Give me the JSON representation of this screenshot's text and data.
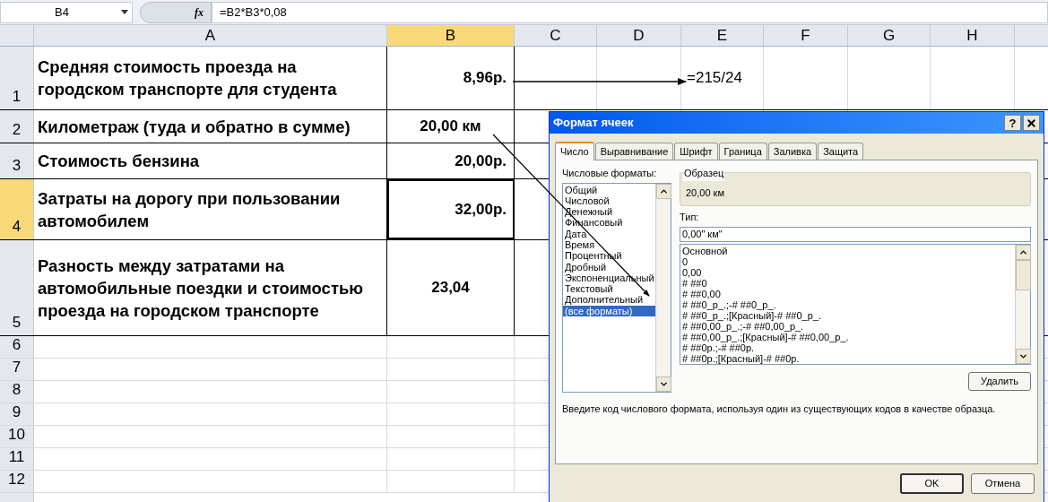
{
  "formula_bar": {
    "name_box": "B4",
    "function_label": "fx",
    "formula": "=B2*B3*0,08"
  },
  "sheet": {
    "columns": [
      {
        "label": "A",
        "selected": false
      },
      {
        "label": "B",
        "selected": true
      },
      {
        "label": "C",
        "selected": false
      },
      {
        "label": "D",
        "selected": false
      },
      {
        "label": "E",
        "selected": false
      },
      {
        "label": "F",
        "selected": false
      },
      {
        "label": "G",
        "selected": false
      },
      {
        "label": "H",
        "selected": false
      }
    ],
    "rows": [
      {
        "label": "1",
        "selected": false,
        "a": "Средняя стоимость проезда на городском транспорте для студента",
        "b": "8,96р.",
        "b_selected": false,
        "e": "=215/24"
      },
      {
        "label": "2",
        "selected": false,
        "a": "Километраж (туда и обратно в сумме)",
        "b": "20,00 км",
        "b_selected": false
      },
      {
        "label": "3",
        "selected": false,
        "a": "Стоимость бензина",
        "b": "20,00р.",
        "b_selected": false
      },
      {
        "label": "4",
        "selected": true,
        "a": "Затраты на дорогу при пользовании автомобилем",
        "b": "32,00р.",
        "b_selected": true
      },
      {
        "label": "5",
        "selected": false,
        "a": "Разность между затратами на автомобильные поездки и стоимостью проезда на городском транспорте",
        "b": "23,04",
        "b_selected": false
      },
      {
        "label": "6",
        "selected": false
      },
      {
        "label": "7",
        "selected": false
      },
      {
        "label": "8",
        "selected": false
      },
      {
        "label": "9",
        "selected": false
      },
      {
        "label": "10",
        "selected": false
      },
      {
        "label": "11",
        "selected": false
      },
      {
        "label": "12",
        "selected": false
      }
    ]
  },
  "dialog": {
    "title": "Формат ячеек",
    "help": "?",
    "tabs": [
      {
        "label": "Число",
        "selected": true
      },
      {
        "label": "Выравнивание",
        "selected": false
      },
      {
        "label": "Шрифт",
        "selected": false
      },
      {
        "label": "Граница",
        "selected": false
      },
      {
        "label": "Заливка",
        "selected": false
      },
      {
        "label": "Защита",
        "selected": false
      }
    ],
    "categories_label": "Числовые форматы:",
    "categories": [
      {
        "label": "Общий",
        "selected": false
      },
      {
        "label": "Числовой",
        "selected": false
      },
      {
        "label": "Денежный",
        "selected": false
      },
      {
        "label": "Финансовый",
        "selected": false
      },
      {
        "label": "Дата",
        "selected": false
      },
      {
        "label": "Время",
        "selected": false
      },
      {
        "label": "Процентный",
        "selected": false
      },
      {
        "label": "Дробный",
        "selected": false
      },
      {
        "label": "Экспоненциальный",
        "selected": false
      },
      {
        "label": "Текстовый",
        "selected": false
      },
      {
        "label": "Дополнительный",
        "selected": false
      },
      {
        "label": "(все форматы)",
        "selected": true
      }
    ],
    "sample_label": "Образец",
    "sample_value": "20,00 км",
    "type_label": "Тип:",
    "type_value": "0,00\" км\"",
    "formats": [
      {
        "label": "Основной",
        "selected": false
      },
      {
        "label": "0",
        "selected": false
      },
      {
        "label": "0,00",
        "selected": false
      },
      {
        "label": "# ##0",
        "selected": false
      },
      {
        "label": "# ##0,00",
        "selected": false
      },
      {
        "label": "# ##0_р_.;-# ##0_р_.",
        "selected": false
      },
      {
        "label": "# ##0_р_.;[Красный]-# ##0_р_.",
        "selected": false
      },
      {
        "label": "# ##0,00_р_.;-# ##0,00_р_.",
        "selected": false
      },
      {
        "label": "# ##0,00_р_.;[Красный]-# ##0,00_р_.",
        "selected": false
      },
      {
        "label": "# ##0р.;-# ##0р.",
        "selected": false
      },
      {
        "label": "# ##0р.;[Красный]-# ##0р.",
        "selected": false
      }
    ],
    "delete_button": "Удалить",
    "hint": "Введите код числового формата, используя один из существующих кодов в качестве образца.",
    "ok_button": "OK",
    "cancel_button": "Отмена"
  }
}
